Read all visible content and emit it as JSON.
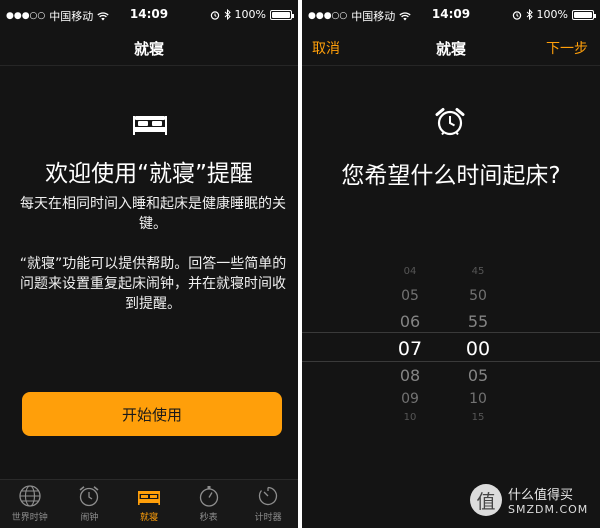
{
  "status": {
    "carrier": "中国移动",
    "time": "14:09",
    "battery": "100%",
    "battery_level": 1.0
  },
  "left": {
    "nav_title": "就寝",
    "title": "欢迎使用“就寝”提醒",
    "desc1": "每天在相同时间入睡和起床是健康睡眠的关键。",
    "desc2": "“就寝”功能可以提供帮助。回答一些简单的问题来设置重复起床闹钟，并在就寝时间收到提醒。",
    "start_button": "开始使用",
    "tabs": [
      {
        "label": "世界时钟",
        "icon": "globe-icon",
        "active": false
      },
      {
        "label": "闹钟",
        "icon": "alarm-clock-icon",
        "active": false
      },
      {
        "label": "就寝",
        "icon": "bed-icon",
        "active": true
      },
      {
        "label": "秒表",
        "icon": "stopwatch-icon",
        "active": false
      },
      {
        "label": "计时器",
        "icon": "timer-icon",
        "active": false
      }
    ]
  },
  "right": {
    "cancel": "取消",
    "nav_title": "就寝",
    "next": "下一步",
    "question": "您希望什么时间起床?",
    "hours": [
      "04",
      "05",
      "06",
      "07",
      "08",
      "09",
      "10"
    ],
    "minutes": [
      "45",
      "50",
      "55",
      "00",
      "05",
      "10",
      "15"
    ],
    "selected_hour": "07",
    "selected_minute": "00"
  },
  "watermark": {
    "badge": "值",
    "text": "什么值得买",
    "sub": "SMZDM.COM"
  },
  "colors": {
    "accent": "#ff9f0a",
    "background": "#141414"
  }
}
